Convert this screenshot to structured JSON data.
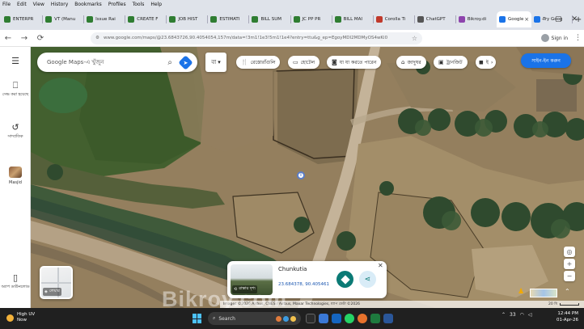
{
  "menu": [
    "File",
    "Edit",
    "View",
    "History",
    "Bookmarks",
    "Profiles",
    "Tools",
    "Help"
  ],
  "tabs": [
    {
      "title": "ENTERPR",
      "color": "#2f7d32"
    },
    {
      "title": "VT (Manu",
      "color": "#2f7d32"
    },
    {
      "title": "Issue Rai",
      "color": "#2f7d32"
    },
    {
      "title": "CREATE F",
      "color": "#2f7d32"
    },
    {
      "title": "JOB HIST",
      "color": "#2f7d32"
    },
    {
      "title": "ESTIMATI",
      "color": "#2f7d32"
    },
    {
      "title": "BILL SUM",
      "color": "#2f7d32"
    },
    {
      "title": "JC PP PR",
      "color": "#2f7d32"
    },
    {
      "title": "BILL MAI",
      "color": "#2f7d32"
    },
    {
      "title": "Corolla Ti",
      "color": "#c0392b"
    },
    {
      "title": "ChatGPT",
      "color": "#555555"
    },
    {
      "title": "Bikroy.di",
      "color": "#8e44ad"
    },
    {
      "title": "Google",
      "color": "#1a73e8",
      "active": true
    },
    {
      "title": "Try Goog",
      "color": "#1a73e8"
    }
  ],
  "nav": {
    "url": "www.google.com/maps/@23.6843726,90.4054054,157m/data=!3m1!1e3!5m1!1e4?entry=ttu&g_ep=EgoyMDI2MDMyOS4wKi0",
    "signin": "Sign in"
  },
  "left_panel": {
    "menu_icon": "menu-icon",
    "saved": "সেভ করা হয়েছে",
    "recent": "সাম্প্রতিক",
    "masjid": "Masjid",
    "app": "অ্যাপ ডাউনলোড"
  },
  "search": {
    "placeholder": "Google Maps-এ খুঁজুন"
  },
  "chips": {
    "lang": "বা",
    "restaurants": "রেস্তোরাঁগুলি",
    "hotels": "হোটেল",
    "things": "যা যা করতে পারেন",
    "museums": "জাদুঘর",
    "transit": "ট্রানজিট",
    "more": "ই"
  },
  "signin_button": "সাইন-ইন করুন",
  "layers": {
    "label": "লেয়ার"
  },
  "place_card": {
    "name": "Chunkutia",
    "coords": "23.684378, 90.405461",
    "photo_label": "রাস্তার দৃশ্য"
  },
  "attribution": {
    "text": "Images ©2026 Airbus, CNES / Airbus, Maxar Technologies, ম্যাপ ডেটা ©2026",
    "scale": "20 মি"
  },
  "watermark": "Bikroy.com",
  "taskbar": {
    "weather_title": "High UV",
    "weather_sub": "Now",
    "search": "Search",
    "temp": "33",
    "time": "12:44 PM",
    "date": "01-Apr-26"
  },
  "colors": {
    "accent": "#1a73e8",
    "teal": "#0b7a75"
  }
}
